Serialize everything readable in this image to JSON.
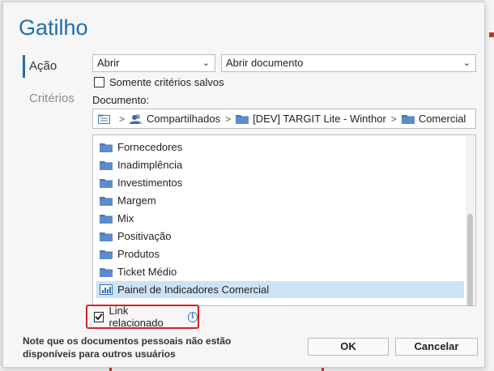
{
  "dialog": {
    "title": "Gatilho",
    "nav": [
      {
        "label": "Ação",
        "active": true
      },
      {
        "label": "Critérios",
        "active": false
      }
    ],
    "action_select": "Abrir",
    "target_select": "Abrir documento",
    "saved_criteria_label": "Somente critérios salvos",
    "document_label": "Documento:",
    "breadcrumb": [
      "Compartilhados",
      "[DEV] TARGIT Lite - Winthor",
      "Comercial"
    ],
    "items": [
      {
        "label": "Fornecedores",
        "icon": "folder-icon"
      },
      {
        "label": "Inadimplência",
        "icon": "folder-icon"
      },
      {
        "label": "Investimentos",
        "icon": "folder-icon"
      },
      {
        "label": "Margem",
        "icon": "folder-icon"
      },
      {
        "label": "Mix",
        "icon": "folder-icon"
      },
      {
        "label": "Positivação",
        "icon": "folder-icon"
      },
      {
        "label": "Produtos",
        "icon": "folder-icon"
      },
      {
        "label": "Ticket Médio",
        "icon": "folder-icon"
      },
      {
        "label": "Painel de Indicadores Comercial",
        "icon": "dashboard-icon",
        "selected": true
      }
    ],
    "link_label": "Link relacionado",
    "link_checked": true,
    "note": "Note que os documentos pessoais não estão disponíveis para outros usuários",
    "ok_label": "OK",
    "cancel_label": "Cancelar"
  },
  "colors": {
    "accent": "#1f6fae",
    "selection": "#cde3f5",
    "highlight_border": "#d32020",
    "folder": "#4a7ab8"
  }
}
